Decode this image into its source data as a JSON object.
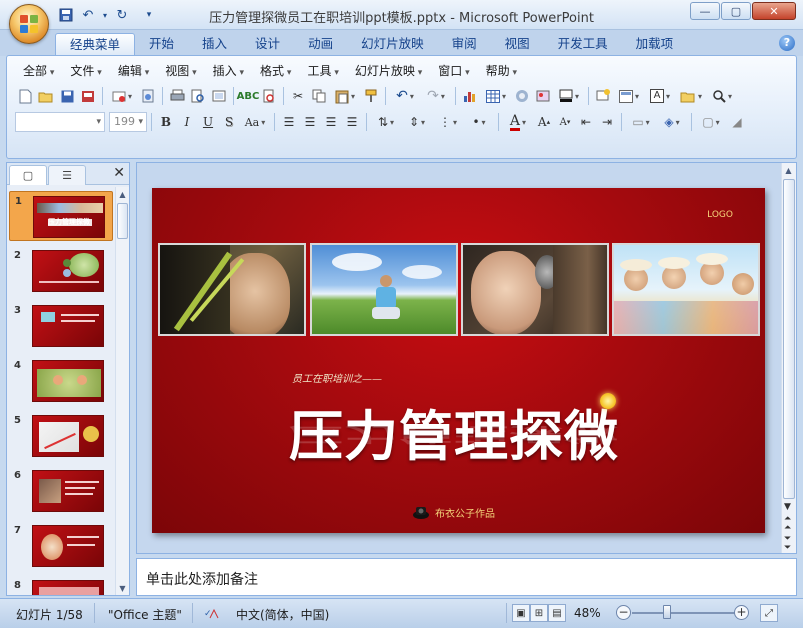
{
  "window": {
    "title": "压力管理探微员工在职培训ppt模板.pptx - Microsoft PowerPoint",
    "controls": {
      "minimize": "—",
      "maximize": "▢",
      "close": "✕"
    }
  },
  "quick_access": [
    {
      "name": "save-icon",
      "glyph": "💾"
    },
    {
      "name": "undo-icon",
      "glyph": "↶"
    },
    {
      "name": "redo-icon",
      "glyph": "↻"
    },
    {
      "name": "customize-qat-icon",
      "glyph": "▾"
    }
  ],
  "ribbon_tabs": [
    "经典菜单",
    "开始",
    "插入",
    "设计",
    "动画",
    "幻灯片放映",
    "审阅",
    "视图",
    "开发工具",
    "加载项"
  ],
  "active_tab": 0,
  "help_label": "?",
  "classic_menu": [
    "全部",
    "文件",
    "编辑",
    "视图",
    "插入",
    "格式",
    "工具",
    "幻灯片放映",
    "窗口",
    "帮助"
  ],
  "toolbar": {
    "font_name": "",
    "font_size": "199"
  },
  "slides_panel": {
    "tab_slides_glyph": "▢",
    "tab_outline_glyph": "☰",
    "close_glyph": "✕",
    "slide_numbers": [
      "1",
      "2",
      "3",
      "4",
      "5",
      "6",
      "7",
      "8"
    ],
    "selected_index": 0,
    "thumb1_title": "压力管理探微"
  },
  "slide": {
    "logo": "LOGO",
    "subtitle": "员工在职培训之——",
    "title": "压力管理探微",
    "author": "布衣公子作品"
  },
  "notes": {
    "placeholder": "单击此处添加备注"
  },
  "status": {
    "slide_counter": "幻灯片 1/58",
    "theme": "\"Office 主题\"",
    "language": "中文(简体，中国)",
    "zoom": "48%",
    "zoom_fraction": 0.48
  },
  "colors": {
    "slide_red": "#a40a0e",
    "accent_gold": "#f3d27a",
    "selection_orange": "#f3a64b"
  }
}
